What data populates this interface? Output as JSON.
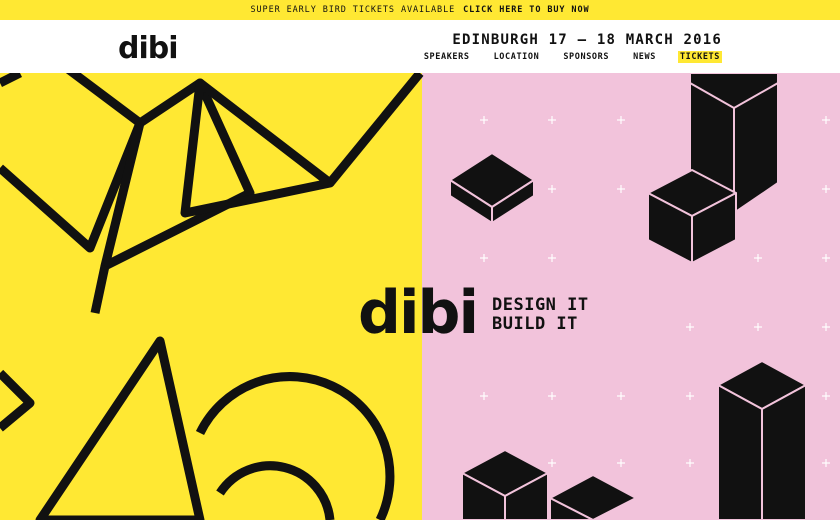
{
  "promo": {
    "text": "SUPER EARLY BIRD TICKETS AVAILABLE",
    "link": "CLICK HERE TO BUY NOW"
  },
  "header": {
    "logo": "dibi",
    "event": "EDINBURGH 17 – 18 MARCH 2016",
    "nav": [
      "SPEAKERS",
      "LOCATION",
      "SPONSORS",
      "NEWS",
      "TICKETS"
    ]
  },
  "hero": {
    "logo": "dibi",
    "tagline_line1": "DESIGN IT",
    "tagline_line2": "BUILD IT"
  },
  "colors": {
    "yellow": "#ffe833",
    "pink": "#f2c3db",
    "black": "#111111"
  }
}
